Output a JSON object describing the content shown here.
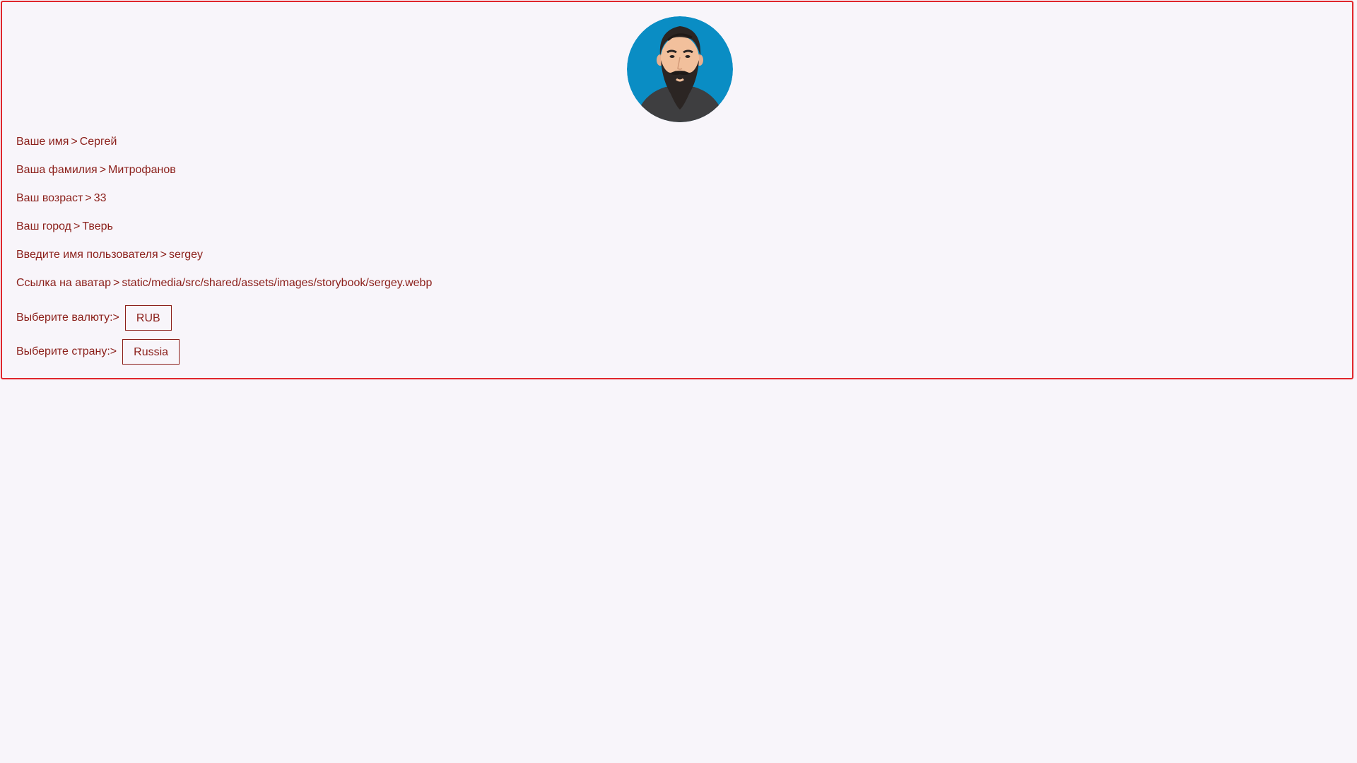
{
  "profile": {
    "fields": [
      {
        "label": "Ваше имя",
        "separator": ">",
        "value": "Сергей"
      },
      {
        "label": "Ваша фамилия",
        "separator": ">",
        "value": "Митрофанов"
      },
      {
        "label": "Ваш возраст",
        "separator": ">",
        "value": "33"
      },
      {
        "label": "Ваш город",
        "separator": ">",
        "value": "Тверь"
      },
      {
        "label": "Введите имя пользователя",
        "separator": ">",
        "value": "sergey"
      },
      {
        "label": "Ссылка на аватар",
        "separator": ">",
        "value": "static/media/src/shared/assets/images/storybook/sergey.webp"
      }
    ],
    "currency": {
      "label": "Выберите валюту:>",
      "selected": "RUB"
    },
    "country": {
      "label": "Выберите страну:>",
      "selected": "Russia"
    }
  },
  "colors": {
    "text": "#8b1f1a",
    "card_border": "#e0262c",
    "background": "#f8f5fa",
    "avatar_bg": "#0a8dc4"
  },
  "icons": {
    "avatar": "bearded-man-avatar"
  }
}
